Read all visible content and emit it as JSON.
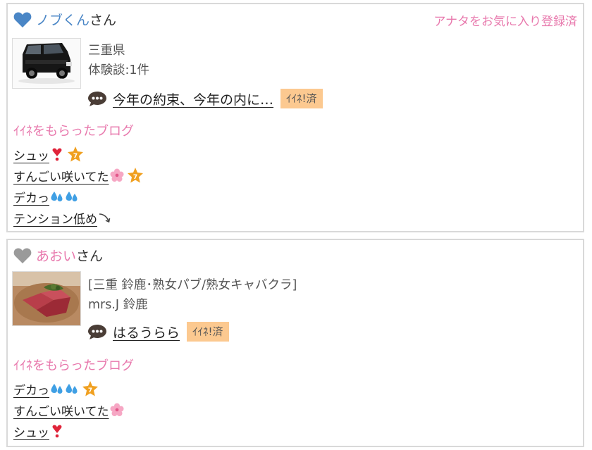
{
  "cards": [
    {
      "user_name": "ノブくん",
      "honorific": "さん",
      "heart_color": "#4a86c6",
      "favorite_link": "アナタをお気に入り登録済",
      "thumb_subject": "black boxy car",
      "meta_lines": [
        "三重県",
        "体験談:1件"
      ],
      "review_title": "今年の約束、今年の内に…",
      "review_badge": "ｲｲﾈ!済",
      "section_title": "ｲｲﾈをもらったブログ",
      "blogs": [
        {
          "text": "シュッ",
          "emoji": "heart-exclamation-icon",
          "star": true
        },
        {
          "text": "すんごい咲いてた",
          "emoji": "cherry-blossom-icon",
          "star": true
        },
        {
          "text": "デカっ",
          "emoji": "sweat-droplets-icon",
          "star": false
        },
        {
          "text": "テンション低め",
          "emoji": "arrow-down-right-icon",
          "star": false
        }
      ]
    },
    {
      "user_name": "あおい",
      "honorific": "さん",
      "heart_color": "#9a9a9a",
      "thumb_subject": "grilled steak on wooden board",
      "meta_lines": [
        "[三重 鈴鹿･熟女パブ/熟女キャバクラ]",
        "mrs.J 鈴鹿"
      ],
      "review_title": "はるうらら",
      "review_badge": "ｲｲﾈ!済",
      "section_title": "ｲｲﾈをもらったブログ",
      "blogs": [
        {
          "text": "デカっ",
          "emoji": "sweat-droplets-icon",
          "star": true
        },
        {
          "text": "すんごい咲いてた",
          "emoji": "cherry-blossom-icon",
          "star": false
        },
        {
          "text": "シュッ",
          "emoji": "heart-exclamation-icon",
          "star": false
        }
      ]
    }
  ],
  "colors": {
    "accent_pink": "#e879ad",
    "link_blue": "#4a86c6",
    "badge_bg": "#fcc990",
    "star_orange": "#f0a020"
  }
}
